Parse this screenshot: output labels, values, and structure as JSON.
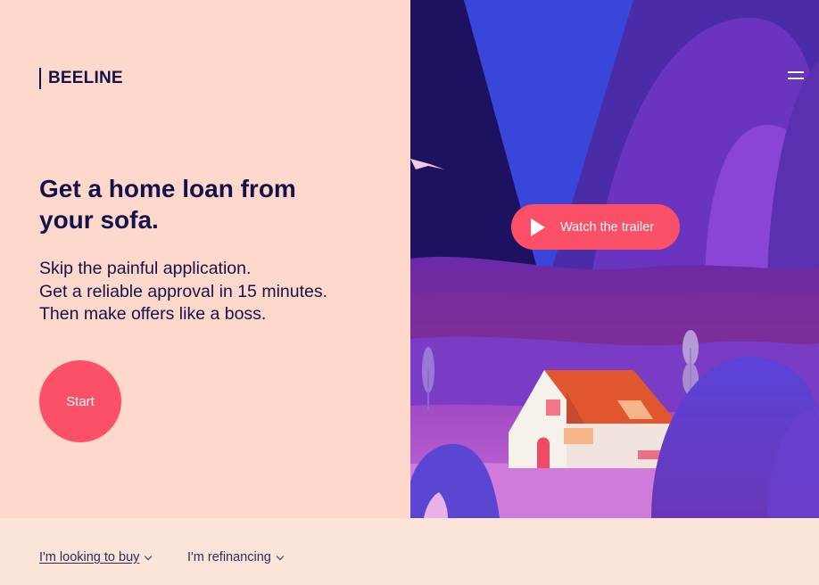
{
  "brand": {
    "name": "BEELINE"
  },
  "hero": {
    "headline": "Get a home loan from your sofa.",
    "lines": [
      "Skip the painful application.",
      "Get a reliable approval in 15 minutes.",
      "Then make offers like a boss."
    ],
    "start_label": "Start"
  },
  "video": {
    "trailer_label": "Watch the trailer"
  },
  "options": [
    {
      "label": "I'm looking to buy"
    },
    {
      "label": "I'm refinancing"
    }
  ],
  "colors": {
    "accent": "#fc4f68",
    "panel": "#fed8cb",
    "ink": "#14124a"
  },
  "icons": {
    "menu": "hamburger-icon",
    "play": "play-icon",
    "chevron": "chevron-down-icon"
  }
}
